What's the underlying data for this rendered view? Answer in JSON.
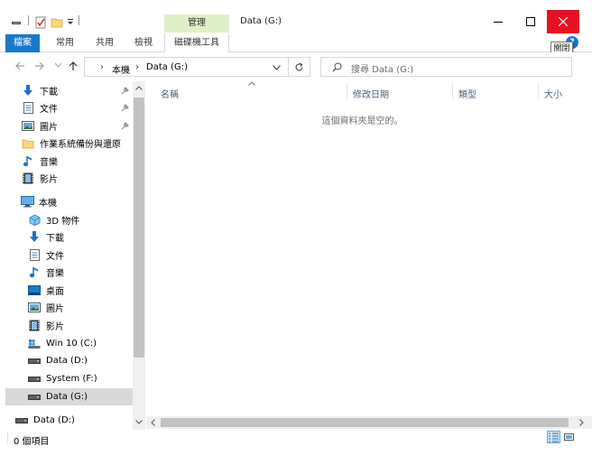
{
  "window": {
    "title": "Data (G:)",
    "context_tab": "管理",
    "tooltip": "關閉"
  },
  "ribbon": {
    "tabs": [
      "檔案",
      "常用",
      "共用",
      "檢視",
      "磁碟機工具"
    ]
  },
  "address": {
    "crumbs": [
      "本機",
      "Data (G:)"
    ],
    "search_placeholder": "搜尋 Data (G:)"
  },
  "nav": {
    "quick_access": [
      {
        "label": "下載",
        "icon": "download-icon",
        "pinned": true
      },
      {
        "label": "文件",
        "icon": "document-icon",
        "pinned": true
      },
      {
        "label": "圖片",
        "icon": "picture-icon",
        "pinned": true
      },
      {
        "label": "作業系統備份與還原",
        "icon": "folder-icon",
        "pinned": false
      },
      {
        "label": "音樂",
        "icon": "music-icon",
        "pinned": false
      },
      {
        "label": "影片",
        "icon": "video-icon",
        "pinned": false
      }
    ],
    "this_pc": {
      "label": "本機",
      "icon": "computer-icon"
    },
    "pc_items": [
      {
        "label": "3D 物件",
        "icon": "3d-objects-icon"
      },
      {
        "label": "下載",
        "icon": "download-icon"
      },
      {
        "label": "文件",
        "icon": "document-icon"
      },
      {
        "label": "音樂",
        "icon": "music-icon"
      },
      {
        "label": "桌面",
        "icon": "desktop-icon"
      },
      {
        "label": "圖片",
        "icon": "picture-icon"
      },
      {
        "label": "影片",
        "icon": "video-icon"
      },
      {
        "label": "Win 10 (C:)",
        "icon": "windows-drive-icon"
      },
      {
        "label": "Data (D:)",
        "icon": "drive-icon"
      },
      {
        "label": "System (F:)",
        "icon": "drive-icon"
      },
      {
        "label": "Data (G:)",
        "icon": "drive-icon",
        "selected": true
      }
    ],
    "other": {
      "label": "Data (D:)",
      "icon": "drive-icon"
    }
  },
  "columns": [
    "名稱",
    "修改日期",
    "類型",
    "大小"
  ],
  "content": {
    "empty_message": "這個資料夾是空的。"
  },
  "status": {
    "item_count": "0 個項目"
  },
  "colors": {
    "accent": "#1979ca",
    "close": "#e81123",
    "context_tab": "#dff0c8",
    "selection": "#d9d9d9"
  }
}
